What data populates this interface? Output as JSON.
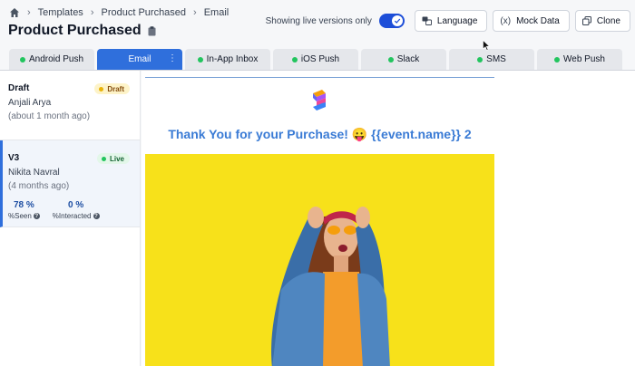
{
  "breadcrumb": {
    "home_icon": "home-icon",
    "items": [
      "Templates",
      "Product Purchased",
      "Email"
    ]
  },
  "page": {
    "title": "Product Purchased",
    "title_icon": "clipboard-icon"
  },
  "toolbar": {
    "live_label": "Showing live versions only",
    "live_toggle_on": true,
    "buttons": [
      {
        "label": "Language",
        "icon": "translate-icon"
      },
      {
        "label": "Mock Data",
        "icon": "variable-icon",
        "glyph": "(x)"
      },
      {
        "label": "Clone",
        "icon": "copy-icon"
      }
    ]
  },
  "tabs": [
    {
      "label": "Android Push",
      "status": "live"
    },
    {
      "label": "Email",
      "status": "active"
    },
    {
      "label": "In-App Inbox",
      "status": "live"
    },
    {
      "label": "iOS Push",
      "status": "live"
    },
    {
      "label": "Slack",
      "status": "live"
    },
    {
      "label": "SMS",
      "status": "live"
    },
    {
      "label": "Web Push",
      "status": "live"
    }
  ],
  "versions": [
    {
      "name": "Draft",
      "author": "Anjali Arya",
      "ago": "(about 1 month ago)",
      "badge": "Draft"
    },
    {
      "name": "V3",
      "author": "Nikita Navral",
      "ago": "(4 months ago)",
      "badge": "Live",
      "stats": [
        {
          "value": "78 %",
          "label": "%Seen"
        },
        {
          "value": "0 %",
          "label": "%Interacted"
        }
      ]
    }
  ],
  "preview": {
    "heading": "Thank You for your Purchase! 😛 {{event.name}} 2",
    "logo_icon": "brand-logo-icon",
    "hero_image": "woman-in-denim-jacket-image"
  },
  "colors": {
    "accent": "#2f6fdc",
    "heading": "#3a7bd5",
    "hero_bg": "#f7e11a",
    "live_dot": "#22c55e",
    "draft_badge_bg": "#fdf3c8"
  }
}
